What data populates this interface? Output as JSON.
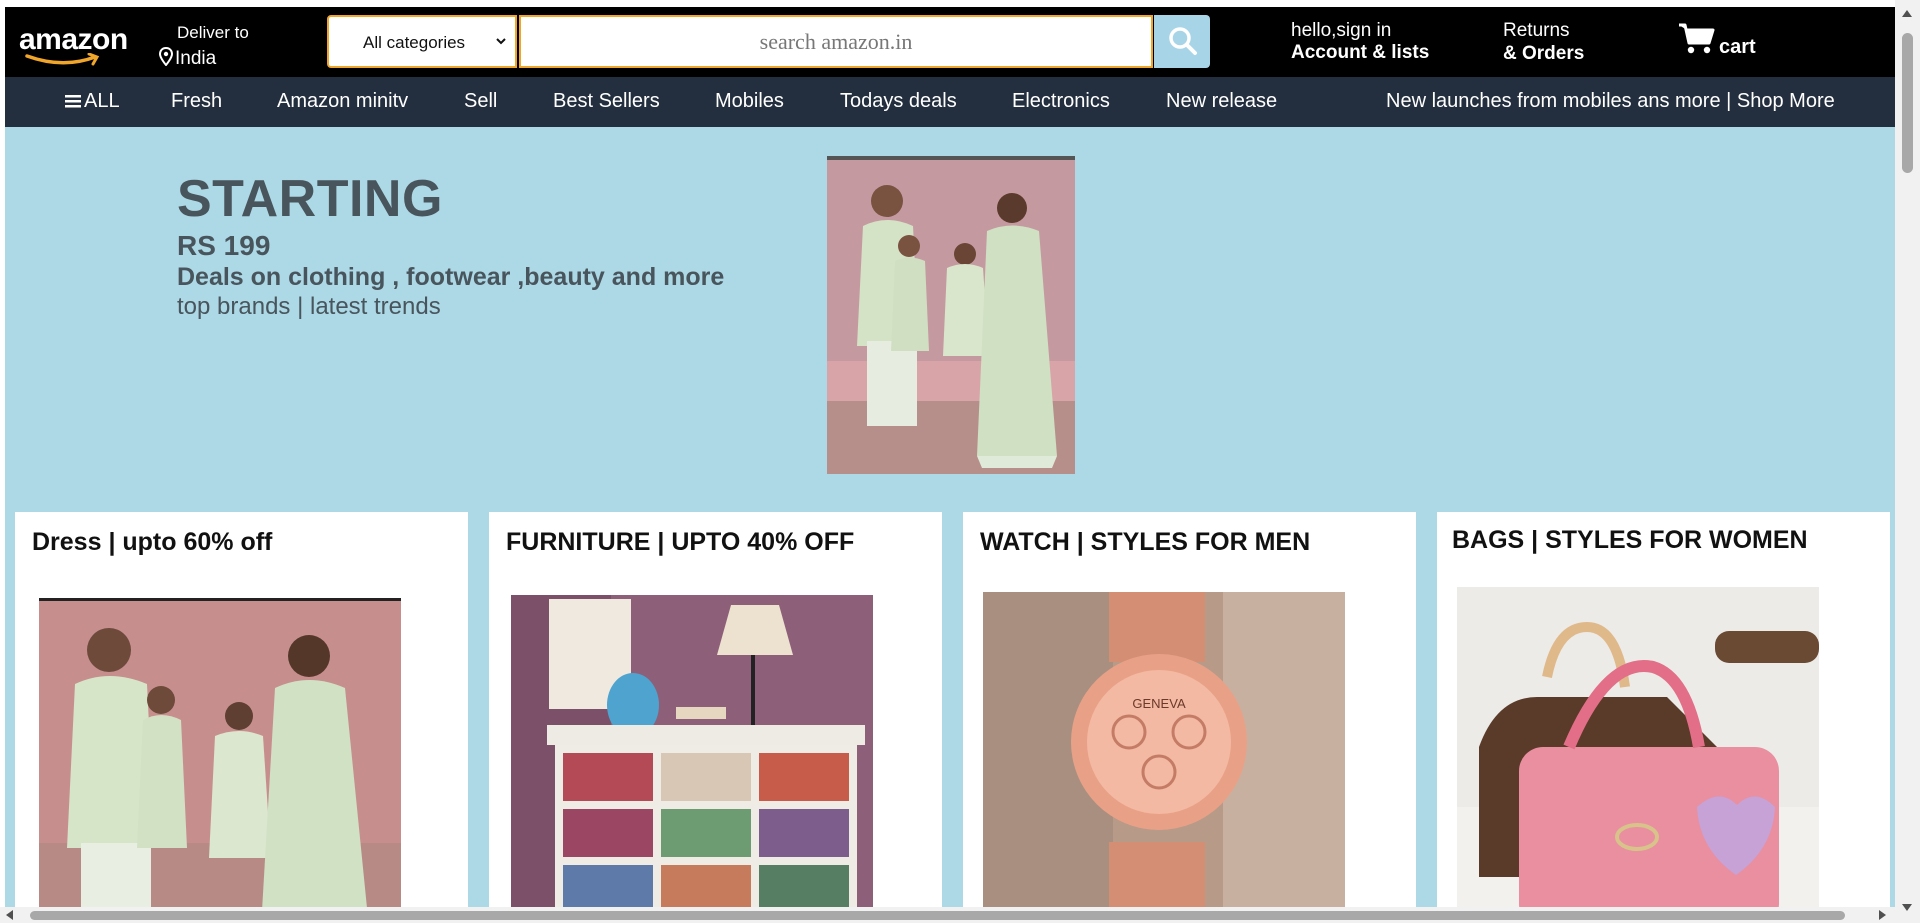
{
  "header": {
    "logo_text": "amazon",
    "deliver_label": "Deliver to",
    "deliver_location": "India",
    "category_selected": "All categories",
    "search_placeholder": "search amazon.in",
    "signin_line1": "hello,sign in",
    "signin_line2": "Account & lists",
    "returns_line1": "Returns",
    "returns_line2": "& Orders",
    "cart_label": "cart",
    "icons": [
      "location-pin-icon",
      "chevron-down-icon",
      "search-icon",
      "cart-icon"
    ]
  },
  "nav": {
    "all_label": "ALL",
    "items": [
      "Fresh",
      "Amazon minitv",
      "Sell",
      "Best Sellers",
      "Mobiles",
      "Todays deals",
      "Electronics",
      "New release"
    ],
    "promo": "New launches from mobiles ans more | Shop More"
  },
  "hero": {
    "headline": "STARTING",
    "price": "RS 199",
    "deals": "Deals on clothing , footwear ,beauty and more",
    "subline": "top brands | latest trends"
  },
  "cards": [
    {
      "title": "Dress | upto 60% off"
    },
    {
      "title": "FURNITURE | UPTO 40% OFF"
    },
    {
      "title": "WATCH | STYLES FOR MEN"
    },
    {
      "title": "BAGS | STYLES FOR WOMEN"
    }
  ],
  "colors": {
    "topbar": "#000000",
    "navbar": "#232f3e",
    "page_bg": "#add8e6",
    "search_border": "#f0a62b",
    "search_button": "#a7d4e6",
    "hero_text": "#48555c"
  }
}
